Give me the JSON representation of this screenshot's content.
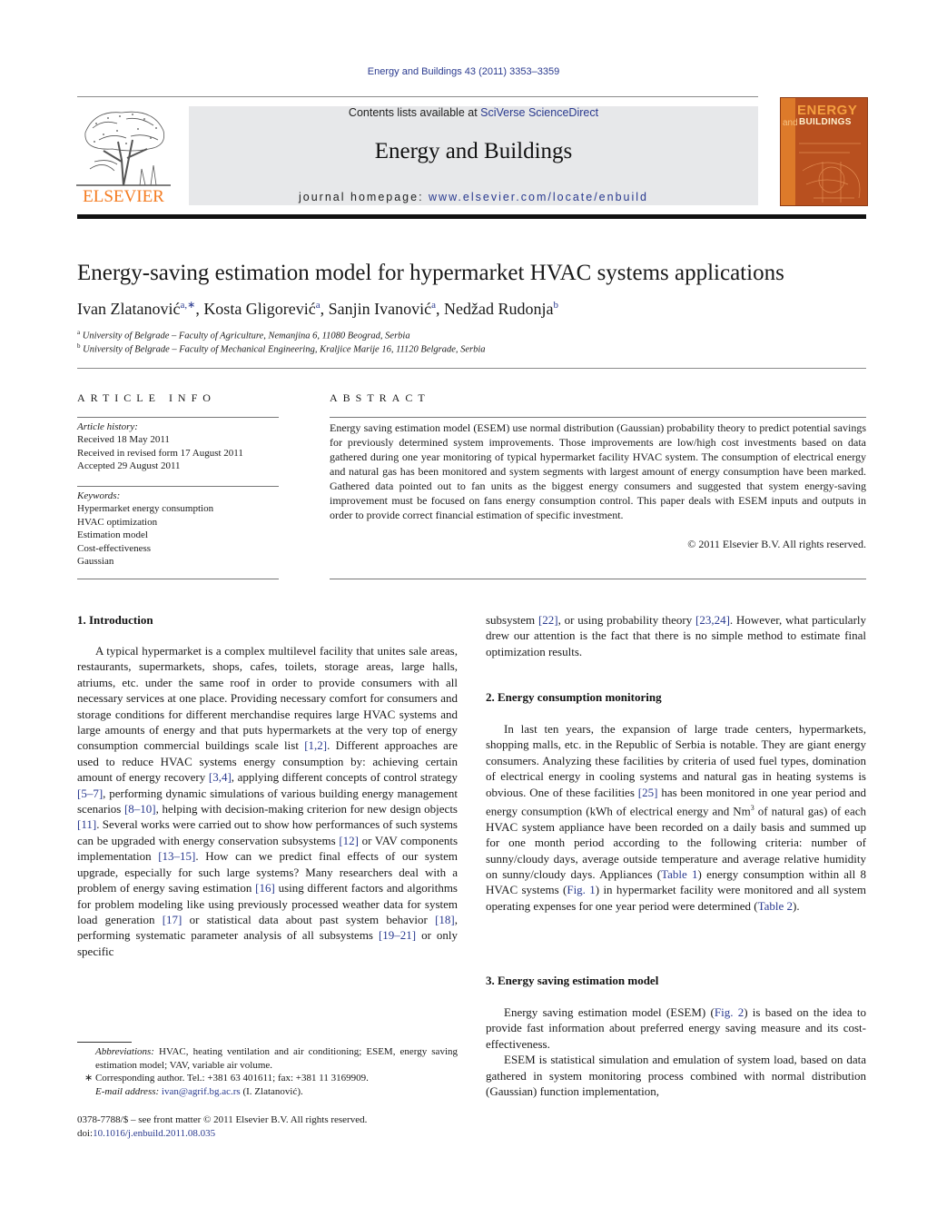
{
  "header": {
    "journal_ref": "Energy and Buildings 43 (2011) 3353–3359",
    "contents_prefix": "Contents lists available at ",
    "contents_link": "SciVerse ScienceDirect",
    "journal_title": "Energy and Buildings",
    "homepage_prefix": "journal homepage: ",
    "homepage_link": "www.elsevier.com/locate/enbuild",
    "publisher_logo_text": "ELSEVIER",
    "cover": {
      "title_top": "ENERGY",
      "title_and": "and",
      "title_bottom": "BUILDINGS"
    },
    "colors": {
      "link": "#2a3a8f",
      "elsevier_orange": "#f47b20",
      "masthead_bg": "#e7e8ea",
      "cover_bg": "#b8501f"
    }
  },
  "article": {
    "title": "Energy-saving estimation model for hypermarket HVAC systems applications",
    "authors": [
      {
        "name": "Ivan Zlatanović",
        "sup": "a,∗"
      },
      {
        "name": "Kosta Gligorević",
        "sup": "a"
      },
      {
        "name": "Sanjin Ivanović",
        "sup": "a"
      },
      {
        "name": "Nedžad Rudonja",
        "sup": "b"
      }
    ],
    "affiliations": [
      {
        "mark": "a",
        "text": "University of Belgrade – Faculty of Agriculture, Nemanjina 6, 11080 Beograd, Serbia"
      },
      {
        "mark": "b",
        "text": "University of Belgrade – Faculty of Mechanical Engineering, Kraljice Marije 16, 11120 Belgrade, Serbia"
      }
    ]
  },
  "article_info": {
    "heading": "ARTICLE INFO",
    "history_label": "Article history:",
    "history": [
      "Received 18 May 2011",
      "Received in revised form 17 August 2011",
      "Accepted 29 August 2011"
    ],
    "keywords_label": "Keywords:",
    "keywords": [
      "Hypermarket energy consumption",
      "HVAC optimization",
      "Estimation model",
      "Cost-effectiveness",
      "Gaussian"
    ]
  },
  "abstract": {
    "heading": "ABSTRACT",
    "text": "Energy saving estimation model (ESEM) use normal distribution (Gaussian) probability theory to predict potential savings for previously determined system improvements. Those improvements are low/high cost investments based on data gathered during one year monitoring of typical hypermarket facility HVAC system. The consumption of electrical energy and natural gas has been monitored and system segments with largest amount of energy consumption have been marked. Gathered data pointed out to fan units as the biggest energy consumers and suggested that system energy-saving improvement must be focused on fans energy consumption control. This paper deals with ESEM inputs and outputs in order to provide correct financial estimation of specific investment.",
    "copyright": "© 2011 Elsevier B.V. All rights reserved."
  },
  "sections": {
    "s1": {
      "heading": "1.  Introduction",
      "segments": [
        {
          "t": "A typical hypermarket is a complex multilevel facility that unites sale areas, restaurants, supermarkets, shops, cafes, toilets, storage areas, large halls, atriums, etc. under the same roof in order to provide consumers with all necessary services at one place. Providing necessary comfort for consumers and storage conditions for different merchandise requires large HVAC systems and large amounts of energy and that puts hypermarkets at the very top of energy consumption commercial buildings scale list "
        },
        {
          "r": "[1,2]"
        },
        {
          "t": ". Different approaches are used to reduce HVAC systems energy consumption by: achieving certain amount of energy recovery "
        },
        {
          "r": "[3,4]"
        },
        {
          "t": ", applying different concepts of control strategy "
        },
        {
          "r": "[5–7]"
        },
        {
          "t": ", performing dynamic simulations of various building energy management scenarios "
        },
        {
          "r": "[8–10]"
        },
        {
          "t": ", helping with decision-making criterion for new design objects "
        },
        {
          "r": "[11]"
        },
        {
          "t": ". Several works were carried out to show how performances of such systems can be upgraded with energy conservation subsystems "
        },
        {
          "r": "[12]"
        },
        {
          "t": " or VAV components implementation "
        },
        {
          "r": "[13–15]"
        },
        {
          "t": ". How can we predict final effects of our system upgrade, especially for such large systems? Many researchers deal with a problem of energy saving estimation "
        },
        {
          "r": "[16]"
        },
        {
          "t": " using different factors and algorithms for problem modeling like using previously processed weather data for system load generation "
        },
        {
          "r": "[17]"
        },
        {
          "t": " or statistical data about past system behavior "
        },
        {
          "r": "[18]"
        },
        {
          "t": ", performing systematic parameter analysis of all subsystems "
        },
        {
          "r": "[19–21]"
        },
        {
          "t": " or only specific"
        }
      ],
      "continuation": [
        {
          "t": "subsystem "
        },
        {
          "r": "[22]"
        },
        {
          "t": ", or using probability theory "
        },
        {
          "r": "[23,24]"
        },
        {
          "t": ". However, what particularly drew our attention is the fact that there is no simple method to estimate final optimization results."
        }
      ]
    },
    "s2": {
      "heading": "2.  Energy consumption monitoring",
      "segments": [
        {
          "t": "In last ten years, the expansion of large trade centers, hypermarkets, shopping malls, etc. in the Republic of Serbia is notable. They are giant energy consumers. Analyzing these facilities by criteria of used fuel types, domination of electrical energy in cooling systems and natural gas in heating systems is obvious. One of these facilities "
        },
        {
          "r": "[25]"
        },
        {
          "t": " has been monitored in one year period and energy consumption (kWh of electrical energy and Nm"
        },
        {
          "sup": "3"
        },
        {
          "t": " of natural gas) of each HVAC system appliance have been recorded on a daily basis and summed up for one month period according to the following criteria: number of sunny/cloudy days, average outside temperature and average relative humidity on sunny/cloudy days. Appliances ("
        },
        {
          "r": "Table 1"
        },
        {
          "t": ") energy consumption within all 8 HVAC systems ("
        },
        {
          "r": "Fig. 1"
        },
        {
          "t": ") in hypermarket facility were monitored and all system operating expenses for one year period were determined ("
        },
        {
          "r": "Table 2"
        },
        {
          "t": ")."
        }
      ]
    },
    "s3": {
      "heading": "3.  Energy saving estimation model",
      "paragraphs": [
        [
          {
            "t": "Energy saving estimation model (ESEM) ("
          },
          {
            "r": "Fig. 2"
          },
          {
            "t": ") is based on the idea to provide fast information about preferred energy saving measure and its cost-effectiveness."
          }
        ],
        [
          {
            "t": "ESEM is statistical simulation and emulation of system load, based on data gathered in system monitoring process combined with normal distribution (Gaussian) function implementation,"
          }
        ]
      ]
    }
  },
  "footnotes": {
    "abbrev_label": "Abbreviations:",
    "abbrev_text": "  HVAC, heating ventilation and air conditioning; ESEM, energy saving estimation model; VAV, variable air volume.",
    "corresponding": "∗  Corresponding author. Tel.: +381 63 401611; fax: +381 11 3169909.",
    "email_label": "E-mail address:",
    "email": "ivan@agrif.bg.ac.rs",
    "email_suffix": " (I. Zlatanović).",
    "front_matter": "0378-7788/$ – see front matter © 2011 Elsevier B.V. All rights reserved.",
    "doi_prefix": "doi:",
    "doi": "10.1016/j.enbuild.2011.08.035"
  }
}
